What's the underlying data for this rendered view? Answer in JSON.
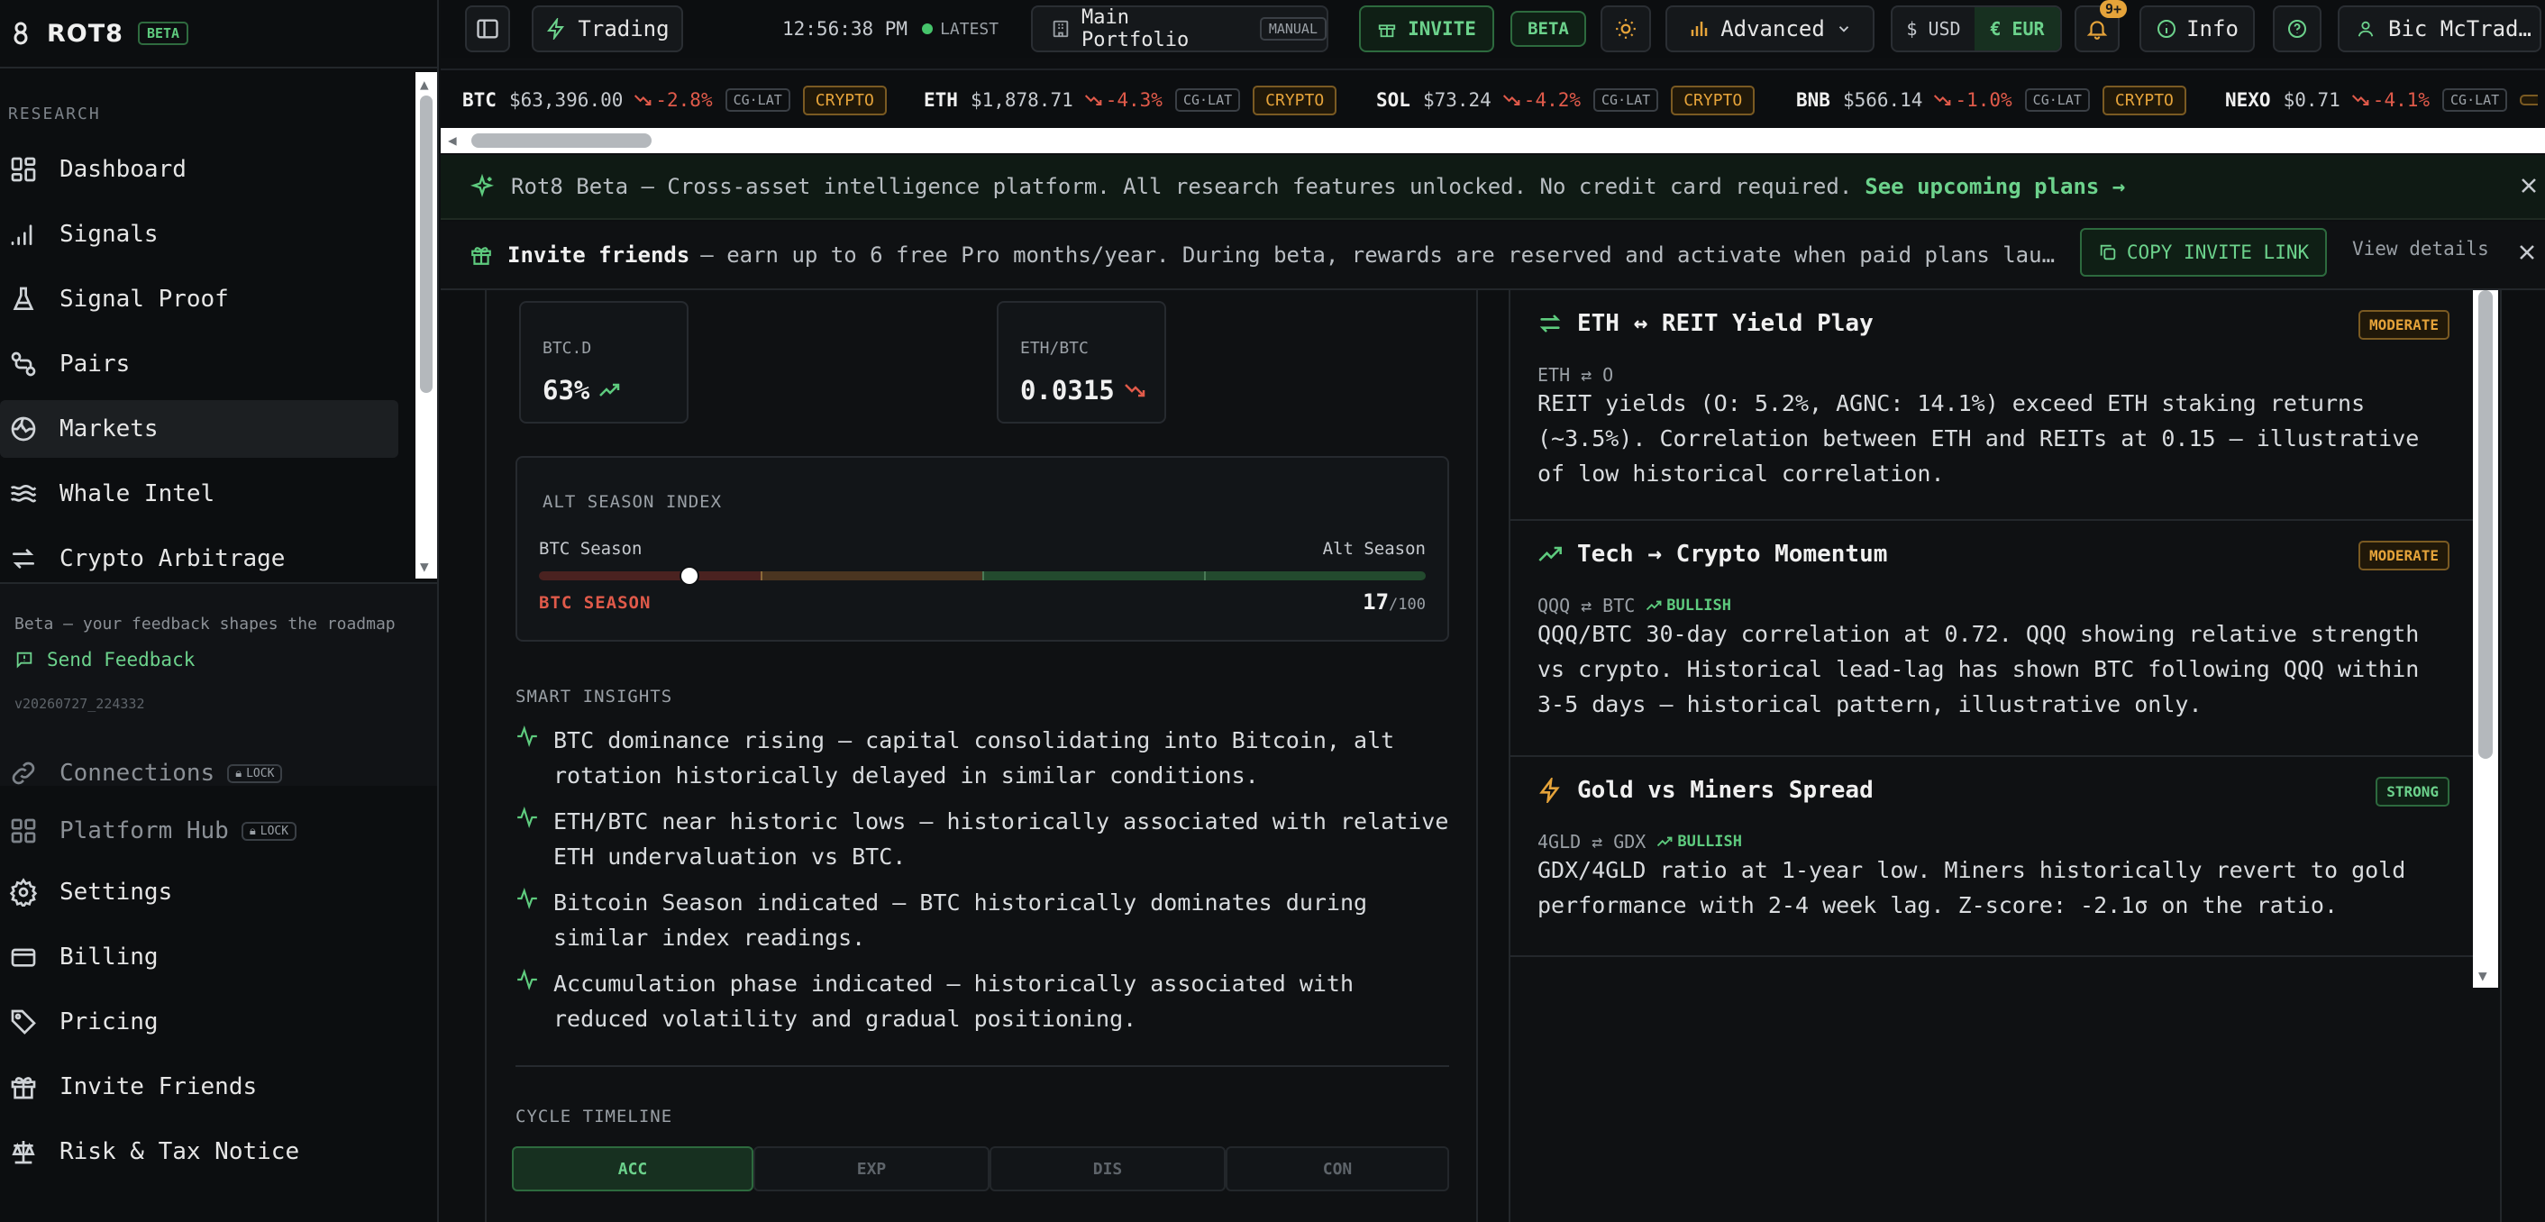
{
  "brand": {
    "name": "ROT8",
    "beta": "BETA"
  },
  "sidebar": {
    "section_research": "RESEARCH",
    "items": [
      {
        "label": "Dashboard",
        "icon": "dashboard-icon"
      },
      {
        "label": "Signals",
        "icon": "signal-bars-icon"
      },
      {
        "label": "Signal Proof",
        "icon": "flask-icon"
      },
      {
        "label": "Pairs",
        "icon": "pairs-icon"
      },
      {
        "label": "Markets",
        "icon": "globe-icon",
        "active": true
      },
      {
        "label": "Whale Intel",
        "icon": "waves-icon"
      },
      {
        "label": "Crypto Arbitrage",
        "icon": "arrows-swap-icon"
      }
    ],
    "feedback": {
      "text": "Beta — your feedback shapes the roadmap",
      "send": "Send Feedback",
      "version": "v20260727_224332"
    },
    "locked_items": [
      {
        "label": "Connections",
        "lock": "LOCK"
      },
      {
        "label": "Platform Hub",
        "lock": "LOCK"
      }
    ],
    "bottom_items": [
      {
        "label": "Settings"
      },
      {
        "label": "Billing"
      },
      {
        "label": "Pricing"
      },
      {
        "label": "Invite Friends"
      },
      {
        "label": "Risk & Tax Notice"
      }
    ]
  },
  "topbar": {
    "trading": "Trading",
    "time": "12:56:38 PM",
    "latest": "LATEST",
    "portfolio": "Main Portfolio",
    "portfolio_mode": "MANUAL",
    "invite": "INVITE",
    "beta": "BETA",
    "mode": "Advanced",
    "currency_usd": "$ USD",
    "currency_eur": "€ EUR",
    "notifications": "9+",
    "info": "Info",
    "user": "Bic McTrad…"
  },
  "ticker": [
    {
      "sym": "BTC",
      "price": "$63,396.00",
      "chg": "-2.8%",
      "src": "CG·LAT",
      "cat": "CRYPTO"
    },
    {
      "sym": "ETH",
      "price": "$1,878.71",
      "chg": "-4.3%",
      "src": "CG·LAT",
      "cat": "CRYPTO"
    },
    {
      "sym": "SOL",
      "price": "$73.24",
      "chg": "-4.2%",
      "src": "CG·LAT",
      "cat": "CRYPTO"
    },
    {
      "sym": "BNB",
      "price": "$566.14",
      "chg": "-1.0%",
      "src": "CG·LAT",
      "cat": "CRYPTO"
    },
    {
      "sym": "NEXO",
      "price": "$0.71",
      "chg": "-4.1%",
      "src": "CG·LAT",
      "cat": ""
    }
  ],
  "banners": {
    "beta_text": "Rot8 Beta — Cross-asset intelligence platform. All research features unlocked. No credit card required.",
    "beta_link": "See upcoming plans →",
    "invite_title": "Invite friends",
    "invite_text": "— earn up to 6 free Pro months/year. During beta, rewards are reserved and activate when paid plans lau…",
    "copy_link": "COPY INVITE LINK",
    "view_details": "View details"
  },
  "market": {
    "btc_d": {
      "label": "BTC.D",
      "value": "63%",
      "trend": "up"
    },
    "eth_btc": {
      "label": "ETH/BTC",
      "value": "0.0315",
      "trend": "down"
    },
    "alt_season": {
      "title": "ALT SEASON INDEX",
      "left_label": "BTC Season",
      "right_label": "Alt Season",
      "state": "BTC SEASON",
      "score": "17",
      "max": "/100",
      "value_pct": 17
    },
    "insights_title": "SMART INSIGHTS",
    "insights": [
      "BTC dominance rising — capital consolidating into Bitcoin, alt rotation historically delayed in similar conditions.",
      "ETH/BTC near historic lows — historically associated with relative ETH undervaluation vs BTC.",
      "Bitcoin Season indicated — BTC historically dominates during similar index readings.",
      "Accumulation phase indicated — historically associated with reduced volatility and gradual positioning."
    ],
    "cycle_title": "CYCLE TIMELINE",
    "phases": [
      "ACC",
      "EXP",
      "DIS",
      "CON"
    ]
  },
  "pairs": [
    {
      "title": "ETH ↔ REIT Yield Play",
      "strength": "MODERATE",
      "a": "ETH",
      "b": "O",
      "bias": "",
      "desc": "REIT yields (O: 5.2%, AGNC: 14.1%) exceed ETH staking returns (~3.5%). Correlation between ETH and REITs at 0.15 — illustrative of low historical correlation.",
      "icon_color": "#5ecb7e"
    },
    {
      "title": "Tech → Crypto Momentum",
      "strength": "MODERATE",
      "a": "QQQ",
      "b": "BTC",
      "bias": "BULLISH",
      "desc": "QQQ/BTC 30-day correlation at 0.72. QQQ showing relative strength vs crypto. Historical lead-lag has shown BTC following QQQ within 3-5 days — historical pattern, illustrative only.",
      "icon_color": "#5ecb7e"
    },
    {
      "title": "Gold vs Miners Spread",
      "strength": "STRONG",
      "a": "4GLD",
      "b": "GDX",
      "bias": "BULLISH",
      "desc": "GDX/4GLD ratio at 1-year low. Miners historically revert to gold performance with 2-4 week lag. Z-score: -2.1σ on the ratio.",
      "icon_color": "#e5a33a"
    }
  ],
  "colors": {
    "accent": "#5ecb7e",
    "warning": "#e5a33a",
    "negative": "#e05a4a",
    "bg": "#0d0f11"
  }
}
